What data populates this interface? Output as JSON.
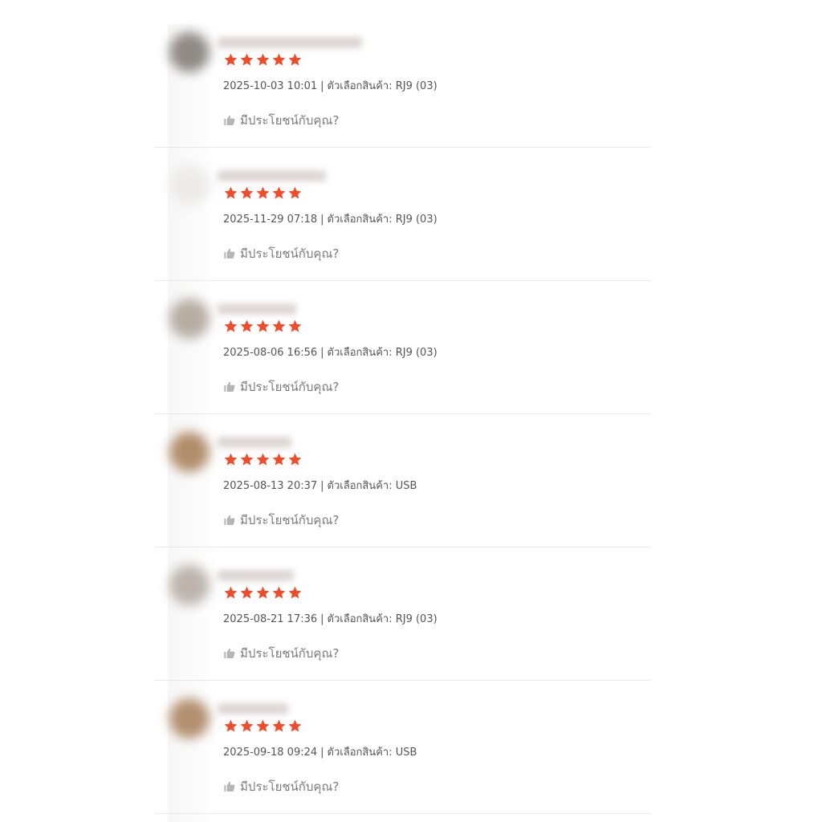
{
  "reviews": [
    {
      "rating": 5,
      "date": "2025-10-03 10:01",
      "variation_label": "ตัวเลือกสินค้า:",
      "variation_value": "RJ9 (03)",
      "helpful_label": "มีประโยชน์กับคุณ?",
      "avatar_color": "#8f8a84",
      "username_mask_width": 180
    },
    {
      "rating": 5,
      "date": "2025-11-29 07:18",
      "variation_label": "ตัวเลือกสินค้า:",
      "variation_value": "RJ9 (03)",
      "helpful_label": "มีประโยชน์กับคุณ?",
      "avatar_color": "#ecebea",
      "username_mask_width": 135
    },
    {
      "rating": 5,
      "date": "2025-08-06 16:56",
      "variation_label": "ตัวเลือกสินค้า:",
      "variation_value": "RJ9 (03)",
      "helpful_label": "มีประโยชน์กับคุณ?",
      "avatar_color": "#b7ada3",
      "username_mask_width": 98
    },
    {
      "rating": 5,
      "date": "2025-08-13 20:37",
      "variation_label": "ตัวเลือกสินค้า:",
      "variation_value": "USB",
      "helpful_label": "มีประโยชน์กับคุณ?",
      "avatar_color": "#b18e6b",
      "username_mask_width": 92
    },
    {
      "rating": 5,
      "date": "2025-08-21 17:36",
      "variation_label": "ตัวเลือกสินค้า:",
      "variation_value": "RJ9 (03)",
      "helpful_label": "มีประโยชน์กับคุณ?",
      "avatar_color": "#bcb4ad",
      "username_mask_width": 95
    },
    {
      "rating": 5,
      "date": "2025-09-18 09:24",
      "variation_label": "ตัวเลือกสินค้า:",
      "variation_value": "USB",
      "helpful_label": "มีประโยชน์กับคุณ?",
      "avatar_color": "#b3906f",
      "username_mask_width": 88
    }
  ],
  "colors": {
    "star": "#ee4d2d",
    "meta_text": "#555555",
    "helpful_text": "#7a7a7a",
    "thumb_icon": "#b5b5b5",
    "divider": "#e8e8e8"
  },
  "icons": {
    "star": "star-icon",
    "thumb": "thumbs-up-icon"
  }
}
